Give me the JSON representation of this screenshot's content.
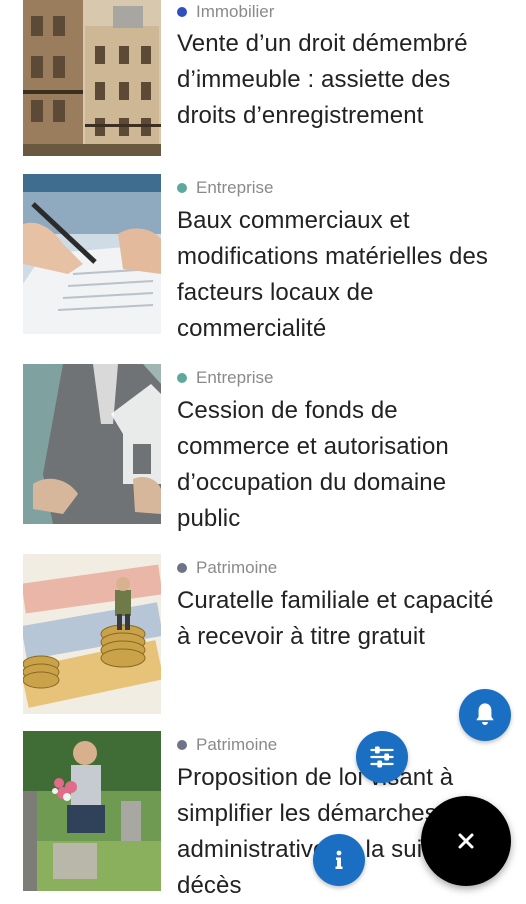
{
  "articles": [
    {
      "category": "Immobilier",
      "category_color": "#2f4fbf",
      "title": "Vente d’un droit démembré d’immeuble : assiette des droits d’enregistrement",
      "image": "building-photo"
    },
    {
      "category": "Entreprise",
      "category_color": "#5fa89c",
      "title": "Baux commerciaux et modifications matérielles des facteurs locaux de commercialité",
      "image": "signing-document-photo"
    },
    {
      "category": "Entreprise",
      "category_color": "#5fa89c",
      "title": "Cession de fonds de commerce et autorisation d’occupation du domaine public",
      "image": "businessman-house-photo"
    },
    {
      "category": "Patrimoine",
      "category_color": "#6e7386",
      "title": "Curatelle familiale et capacité à recevoir à titre gratuit",
      "image": "elderly-man-coins-photo"
    },
    {
      "category": "Patrimoine",
      "category_color": "#6e7386",
      "title": "Proposition de loi visant à simplifier les démarches administratives à la suite d’un décès",
      "image": "man-grave-flowers-photo"
    }
  ],
  "fab": {
    "main_icon": "close-icon",
    "bell_icon": "bell-icon",
    "filter_icon": "sliders-icon",
    "info_icon": "info-icon",
    "main_color": "#000000",
    "secondary_color": "#1a6fc2"
  }
}
